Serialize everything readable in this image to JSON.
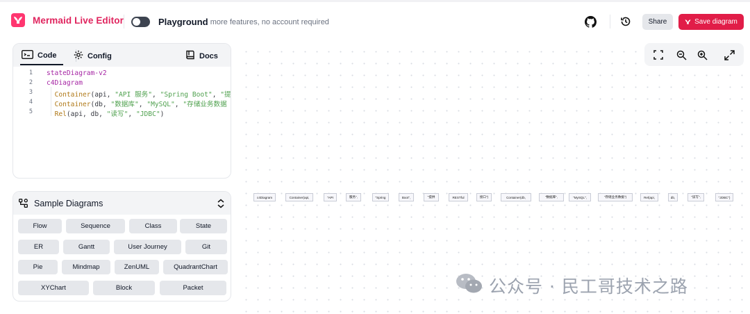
{
  "header": {
    "title": "Mermaid Live Editor",
    "playground_label": "Playground",
    "playground_sub": "- more features, no account required",
    "share_label": "Share",
    "save_label": "Save diagram"
  },
  "editor": {
    "tabs": {
      "code": "Code",
      "config": "Config",
      "docs": "Docs"
    },
    "lines": [
      {
        "n": "1",
        "parts": [
          [
            "kw",
            "stateDiagram-v2"
          ]
        ]
      },
      {
        "n": "2",
        "parts": [
          [
            "kw",
            "c4Diagram"
          ]
        ]
      },
      {
        "n": "3",
        "parts": [
          [
            "ar",
            "  "
          ],
          [
            "fn",
            "Container"
          ],
          [
            "ar",
            "(api, "
          ],
          [
            "st",
            "\"API 服务\""
          ],
          [
            "ar",
            ", "
          ],
          [
            "st",
            "\"Spring Boot\""
          ],
          [
            "ar",
            ", "
          ],
          [
            "st",
            "\"提"
          ]
        ]
      },
      {
        "n": "4",
        "parts": [
          [
            "ar",
            "  "
          ],
          [
            "fn",
            "Container"
          ],
          [
            "ar",
            "(db, "
          ],
          [
            "st",
            "\"数据库\""
          ],
          [
            "ar",
            ", "
          ],
          [
            "st",
            "\"MySQL\""
          ],
          [
            "ar",
            ", "
          ],
          [
            "st",
            "\"存储业务数据"
          ]
        ]
      },
      {
        "n": "5",
        "parts": [
          [
            "ar",
            "  "
          ],
          [
            "fn",
            "Rel"
          ],
          [
            "ar",
            "(api, db, "
          ],
          [
            "st",
            "\"读写\""
          ],
          [
            "ar",
            ", "
          ],
          [
            "st",
            "\"JDBC\""
          ],
          [
            "ar",
            ")"
          ]
        ]
      }
    ]
  },
  "samples": {
    "title": "Sample Diagrams",
    "rows": [
      [
        "Flow",
        "Sequence",
        "Class",
        "State"
      ],
      [
        "ER",
        "Gantt",
        "User Journey",
        "Git"
      ],
      [
        "Pie",
        "Mindmap",
        "ZenUML",
        "QuadrantChart"
      ],
      [
        "XYChart",
        "Block",
        "Packet"
      ]
    ]
  },
  "diagram_nodes": [
    "c4Diagram",
    "Container(api,",
    "\"API",
    "服务\",",
    "\"Spring",
    "Boot\",",
    "\"提供",
    "RESTful",
    "接口\")",
    "Container(db,",
    "\"数据库\",",
    "\"MySQL\",",
    "\"存储业务数据\")",
    "Rel(api,",
    "db,",
    "\"读写\",",
    "\"JDBC\")"
  ],
  "watermark": "公众号 · 民工哥技术之路",
  "colors": {
    "brand": "#e0245e",
    "save": "#e11d48",
    "logo": "#ff3670"
  }
}
